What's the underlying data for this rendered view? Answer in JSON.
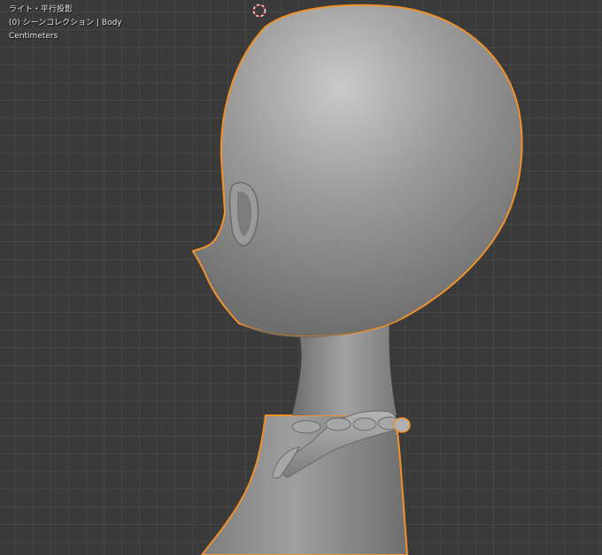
{
  "viewport": {
    "view_name": "ライト・平行投影",
    "collection_info": "(0) シーンコレクション | Body",
    "units": "Centimeters"
  },
  "colors": {
    "background": "#3a3a3a",
    "grid": "#454545",
    "selection_outline": "#f0922b",
    "model_fill": "#8f8f8f",
    "cursor_red": "#d12a2a"
  },
  "icons": {
    "cursor": "3d-cursor-icon"
  }
}
